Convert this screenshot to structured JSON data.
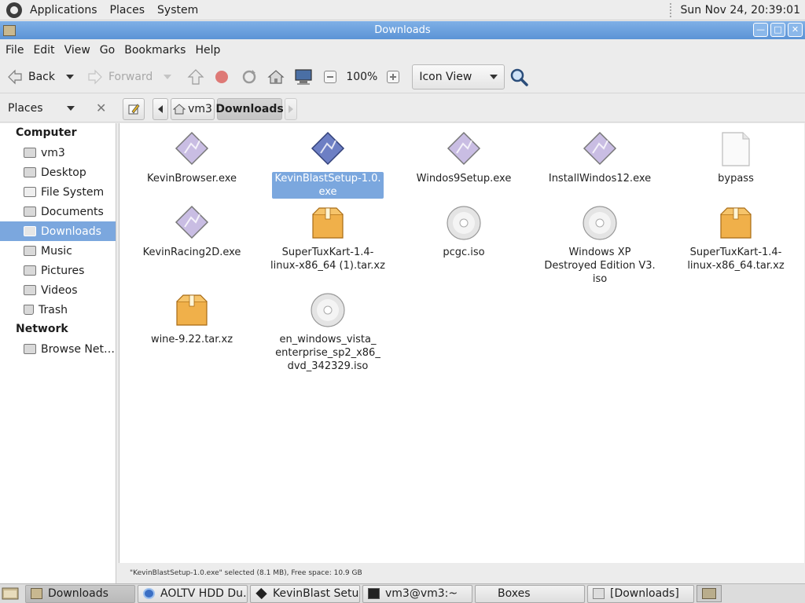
{
  "top_panel": {
    "menus": [
      "Applications",
      "Places",
      "System"
    ],
    "clock": "Sun Nov 24, 20:39:01"
  },
  "window": {
    "title": "Downloads"
  },
  "menubar": [
    "File",
    "Edit",
    "View",
    "Go",
    "Bookmarks",
    "Help"
  ],
  "toolbar": {
    "back_label": "Back",
    "forward_label": "Forward",
    "zoom_level": "100%",
    "view_mode": "Icon View"
  },
  "location": {
    "places_label": "Places",
    "crumbs": [
      "vm3",
      "Downloads"
    ]
  },
  "sidebar": {
    "computer_label": "Computer",
    "computer_items": [
      "vm3",
      "Desktop",
      "File System",
      "Documents",
      "Downloads",
      "Music",
      "Pictures",
      "Videos",
      "Trash"
    ],
    "network_label": "Network",
    "network_items": [
      "Browse Net…"
    ]
  },
  "files": [
    {
      "name": "KevinBrowser.exe",
      "kind": "exe"
    },
    {
      "name": "KevinBlastSetup-1.0.\nexe",
      "kind": "exe-selected"
    },
    {
      "name": "Windos9Setup.exe",
      "kind": "exe"
    },
    {
      "name": "InstallWindos12.exe",
      "kind": "exe"
    },
    {
      "name": "bypass",
      "kind": "blank"
    },
    {
      "name": "KevinRacing2D.exe",
      "kind": "exe"
    },
    {
      "name": "SuperTuxKart-1.4-\nlinux-x86_64 (1).tar.xz",
      "kind": "archive"
    },
    {
      "name": "pcgc.iso",
      "kind": "disc"
    },
    {
      "name": "Windows XP\nDestroyed Edition V3.\niso",
      "kind": "disc"
    },
    {
      "name": "SuperTuxKart-1.4-\nlinux-x86_64.tar.xz",
      "kind": "archive"
    },
    {
      "name": "wine-9.22.tar.xz",
      "kind": "archive"
    },
    {
      "name": "en_windows_vista_\nenterprise_sp2_x86_\ndvd_342329.iso",
      "kind": "disc"
    }
  ],
  "status": "\"KevinBlastSetup-1.0.exe\" selected (8.1 MB), Free space: 10.9 GB",
  "taskbar": [
    "Downloads",
    "AOLTV HDD Du…",
    "KevinBlast Setup",
    "vm3@vm3:~",
    "Boxes",
    "[Downloads]"
  ],
  "colors": {
    "selection": "#7ba7de",
    "titlebar": "#5b93d6"
  }
}
